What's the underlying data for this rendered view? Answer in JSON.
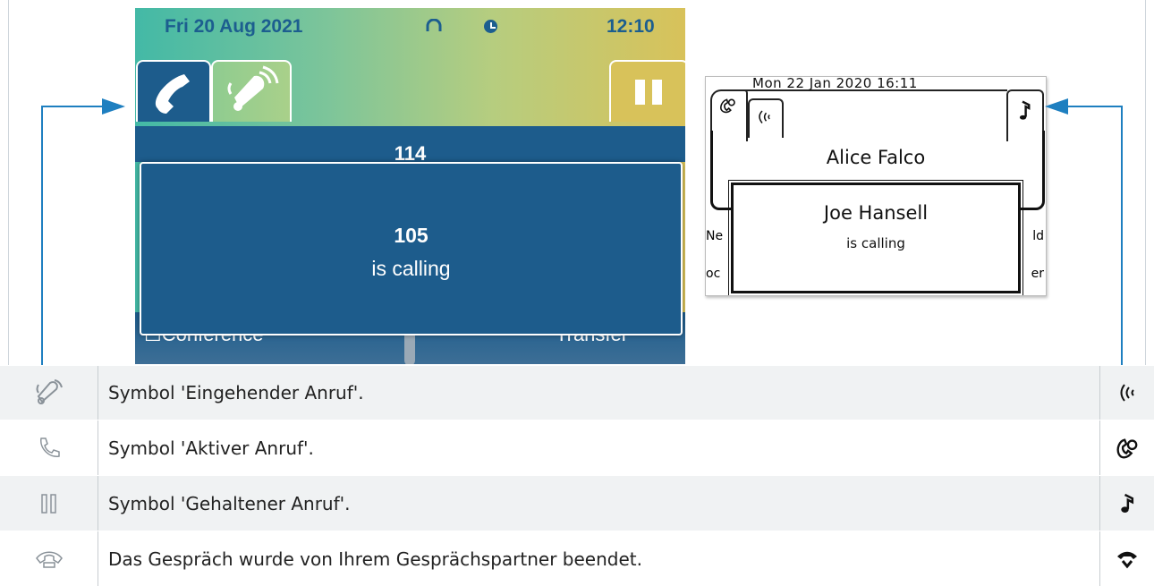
{
  "phone_color": {
    "status_bar": {
      "date": "Fri 20 Aug 2021",
      "time": "12:10",
      "icons": [
        "headset-icon",
        "clock-icon"
      ]
    },
    "tabs": [
      {
        "icon": "phone-handset-icon",
        "state": "active"
      },
      {
        "icon": "ringing-bell-icon",
        "state": "incoming"
      },
      {
        "icon": "pause-icon",
        "state": "on-hold"
      }
    ],
    "background_call": "114",
    "popup": {
      "number": "105",
      "text": "is calling"
    },
    "softkeys": [
      "☐Conference",
      "Transfer"
    ]
  },
  "phone_mono": {
    "status_bar": {
      "date": "Mon 22 Jan 2020 16:11"
    },
    "tabs": [
      "active-call-icon",
      "incoming-waves-icon",
      "music-note-icon"
    ],
    "active_call_name": "Alice Falco",
    "popup": {
      "name": "Joe Hansell",
      "text": "is calling"
    },
    "fragments": {
      "left_top": "Ne",
      "right_top": "ld",
      "left_bottom": "oc",
      "right_bottom": "er"
    }
  },
  "legend": [
    {
      "left_icon": "ringing-bell-icon",
      "text": "Symbol 'Eingehender Anruf'.",
      "right_icon": "incoming-waves-icon"
    },
    {
      "left_icon": "phone-handset-outline-icon",
      "text": "Symbol 'Aktiver Anruf'.",
      "right_icon": "active-call-icon"
    },
    {
      "left_icon": "pause-outline-icon",
      "text": "Symbol 'Gehaltener Anruf'.",
      "right_icon": "music-note-icon"
    },
    {
      "left_icon": "hangup-handset-icon",
      "text": "Das Gespräch wurde von Ihrem Gesprächspartner beendet.",
      "right_icon": "hangup-icon"
    }
  ],
  "colors": {
    "accent": "#1d5c8c",
    "arrow": "#1e7fc0"
  }
}
